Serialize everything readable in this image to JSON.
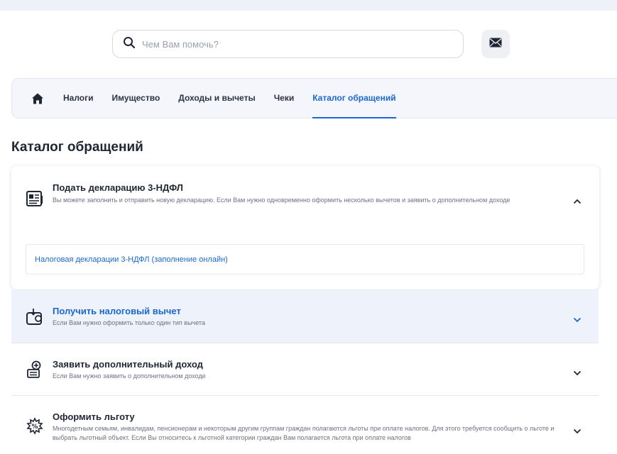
{
  "search": {
    "placeholder": "Чем Вам помочь?"
  },
  "nav": {
    "items": [
      {
        "label": "Налоги"
      },
      {
        "label": "Имущество"
      },
      {
        "label": "Доходы и вычеты"
      },
      {
        "label": "Чеки"
      },
      {
        "label": "Каталог обращений",
        "active": true
      }
    ]
  },
  "page": {
    "title": "Каталог обращений"
  },
  "accordion": {
    "items": [
      {
        "title": "Подать декларацию 3-НДФЛ",
        "description": "Вы можете заполнить и отправить новую декларацию. Если Вам нужно одновременно оформить несколько вычетов и заявить о дополнительном доходе",
        "expanded": true,
        "link": "Налоговая декларации 3-НДФЛ (заполнение онлайн)",
        "icon": "declaration-icon"
      },
      {
        "title": "Получить налоговый вычет",
        "description": "Если Вам нужно оформить только один тип вычета",
        "expanded": false,
        "icon": "wallet-download-icon"
      },
      {
        "title": "Заявить дополнительный доход",
        "description": "Если Вам нужно заявить о дополнительном доходе",
        "expanded": false,
        "icon": "income-add-icon"
      },
      {
        "title": "Оформить льготу",
        "description": "Многодетным семьям, инвалидам, пенсионерам и некоторым другим группам граждан полагаются льготы при оплате налогов. Для этого требуется сообщить о льготе и выбрать льготный объект. Если Вы относитесь к льготной категории граждан Вам полагается льгота при оплате налогов",
        "expanded": false,
        "icon": "benefit-icon"
      }
    ]
  },
  "colors": {
    "accent": "#1a67d3",
    "highlight_bg": "#eef2fb",
    "nav_bg": "#f4f6fb"
  }
}
